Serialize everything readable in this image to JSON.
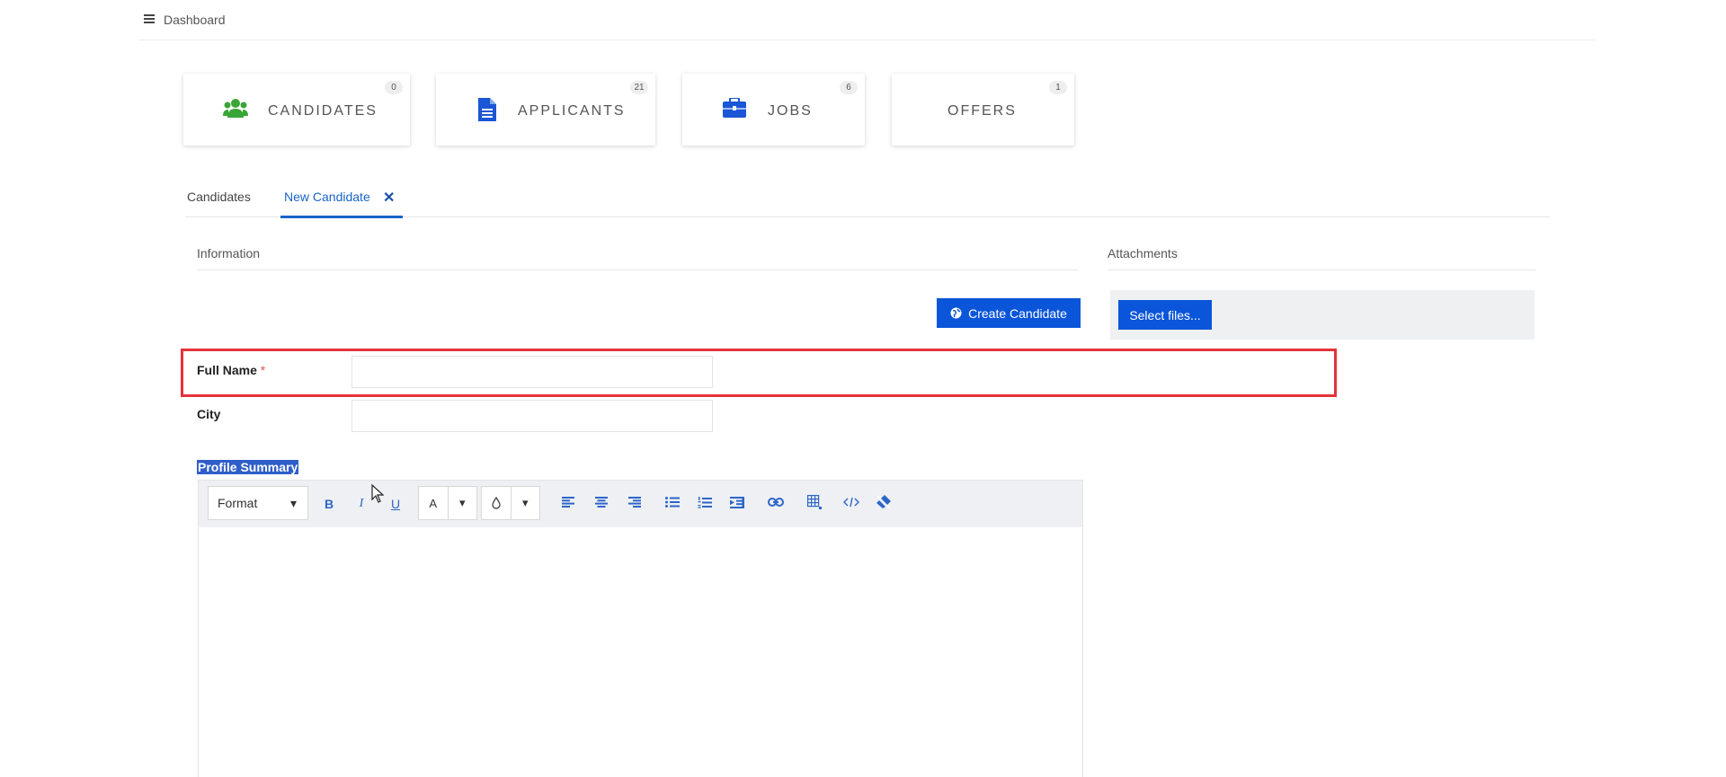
{
  "header": {
    "breadcrumb": "Dashboard"
  },
  "cards": [
    {
      "label": "CANDIDATES",
      "count": "0",
      "icon": "users-icon",
      "color": "#3aa537"
    },
    {
      "label": "APPLICANTS",
      "count": "21",
      "icon": "file-icon",
      "color": "#1a56d6"
    },
    {
      "label": "JOBS",
      "count": "6",
      "icon": "briefcase-icon",
      "color": "#1a56d6"
    },
    {
      "label": "OFFERS",
      "count": "1"
    }
  ],
  "tabs": [
    {
      "label": "Candidates"
    },
    {
      "label": "New Candidate",
      "active": true,
      "closable": true
    }
  ],
  "tab_close": "✕",
  "sections": {
    "information": "Information",
    "attachments": "Attachments"
  },
  "buttons": {
    "create": "Create Candidate",
    "select_files": "Select files..."
  },
  "form": {
    "full_name": {
      "label": "Full Name",
      "required_mark": "*",
      "value": ""
    },
    "city": {
      "label": "City",
      "value": ""
    },
    "profile_summary": {
      "label": "Profile Summary"
    }
  },
  "editor": {
    "format_label": "Format",
    "bold": "B",
    "italic": "I",
    "underline": "U",
    "font_color": "A",
    "caret": "▾"
  },
  "colors": {
    "accent": "#0a55d9",
    "highlight": "#e5333b",
    "link": "#1a64c8"
  }
}
